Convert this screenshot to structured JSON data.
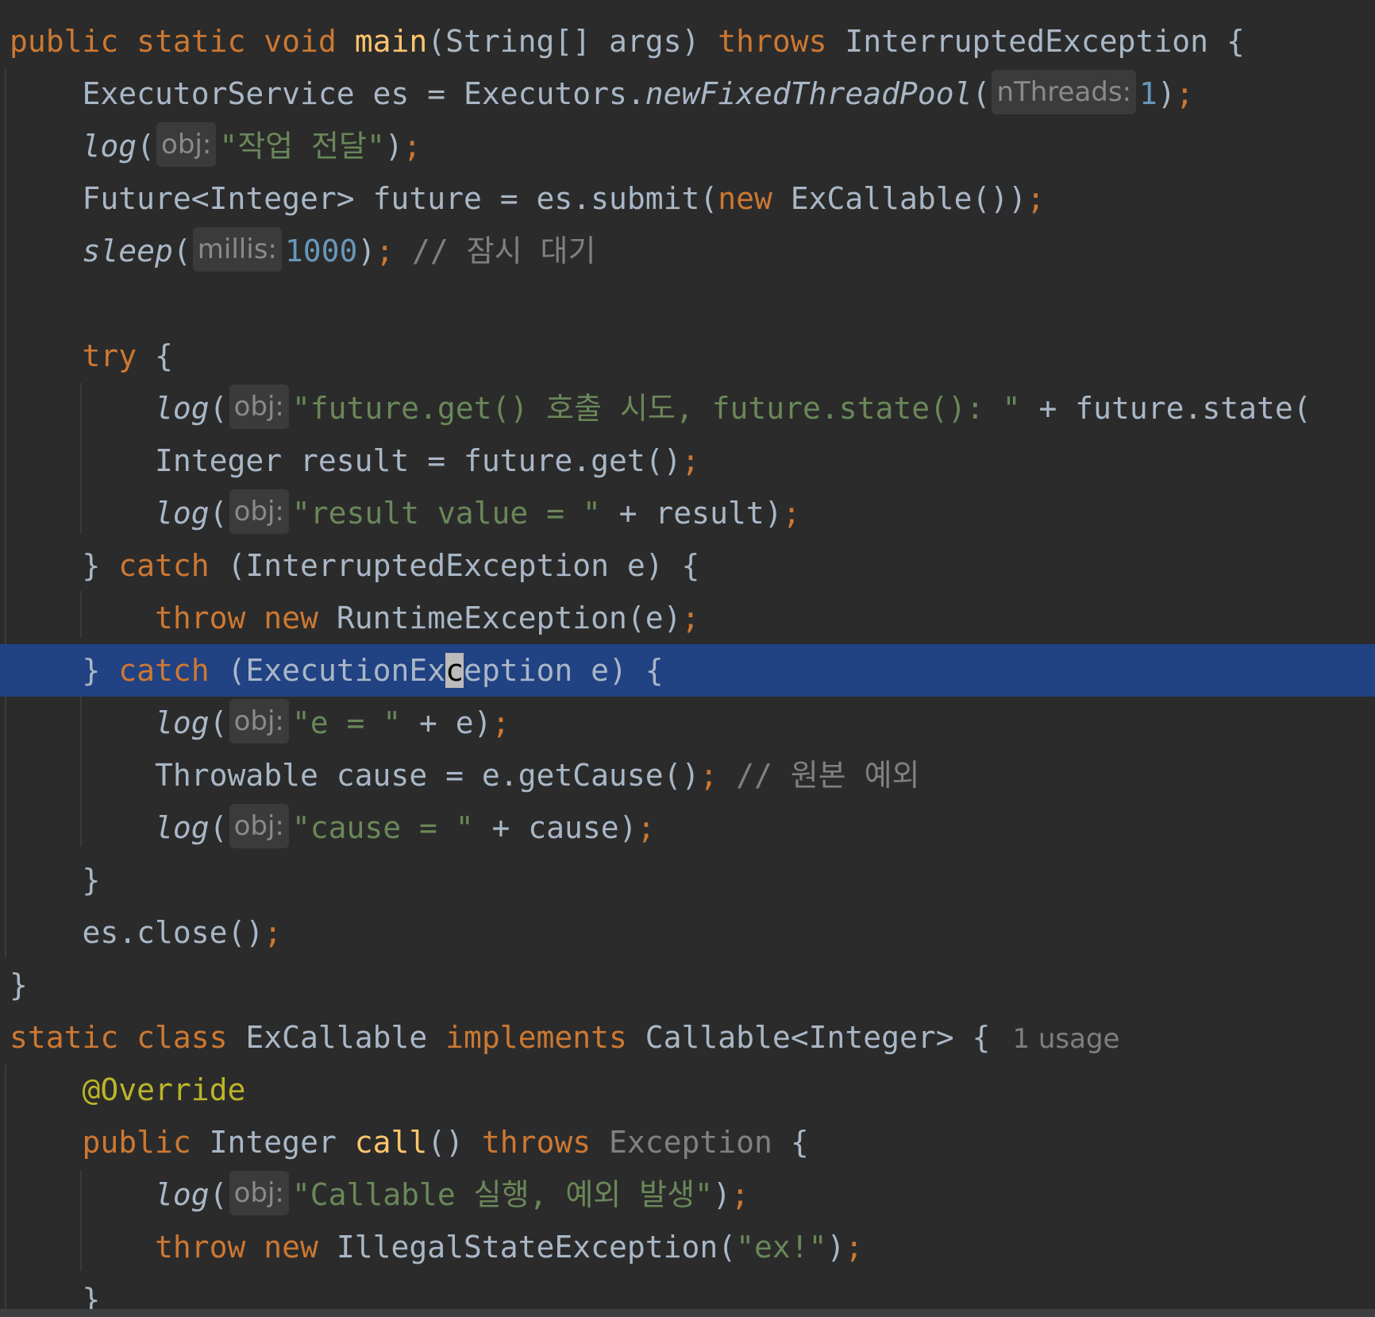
{
  "editor": {
    "language": "Java",
    "colors": {
      "background": "#2b2b2b",
      "current_line": "#214283",
      "keyword": "#cc7832",
      "method_decl": "#ffc66d",
      "string": "#6a8759",
      "number": "#6897bb",
      "comment": "#808080",
      "annotation": "#bbb529",
      "plain": "#a9b7c6"
    },
    "lines": [
      {
        "tokens": [
          {
            "t": "public static void ",
            "c": "kw"
          },
          {
            "t": "main",
            "c": "fn"
          },
          {
            "t": "(String[] args) ",
            "c": ""
          },
          {
            "t": "throws",
            "c": "kw"
          },
          {
            "t": " InterruptedException {",
            "c": ""
          }
        ]
      },
      {
        "tokens": [
          {
            "t": "    ExecutorService es = Executors.",
            "c": ""
          },
          {
            "t": "newFixedThreadPool",
            "c": "ital"
          },
          {
            "t": "(",
            "c": ""
          },
          {
            "t": "nThreads:",
            "c": "hint"
          },
          {
            "t": "1",
            "c": "num"
          },
          {
            "t": ")",
            "c": ""
          },
          {
            "t": ";",
            "c": "kw"
          }
        ]
      },
      {
        "tokens": [
          {
            "t": "    ",
            "c": ""
          },
          {
            "t": "log",
            "c": "ital"
          },
          {
            "t": "(",
            "c": ""
          },
          {
            "t": "obj:",
            "c": "hint"
          },
          {
            "t": "\"작업 전달\"",
            "c": "str"
          },
          {
            "t": ")",
            "c": ""
          },
          {
            "t": ";",
            "c": "kw"
          }
        ]
      },
      {
        "tokens": [
          {
            "t": "    Future<Integer> future = es.submit(",
            "c": ""
          },
          {
            "t": "new",
            "c": "kw"
          },
          {
            "t": " ExCallable())",
            "c": ""
          },
          {
            "t": ";",
            "c": "kw"
          }
        ]
      },
      {
        "tokens": [
          {
            "t": "    ",
            "c": ""
          },
          {
            "t": "sleep",
            "c": "ital"
          },
          {
            "t": "(",
            "c": ""
          },
          {
            "t": "millis:",
            "c": "hint"
          },
          {
            "t": "1000",
            "c": "num"
          },
          {
            "t": ")",
            "c": ""
          },
          {
            "t": ";",
            "c": "kw"
          },
          {
            "t": " // 잠시 대기",
            "c": "cmt"
          }
        ]
      },
      {
        "tokens": []
      },
      {
        "tokens": [
          {
            "t": "    ",
            "c": ""
          },
          {
            "t": "try",
            "c": "kw"
          },
          {
            "t": " {",
            "c": ""
          }
        ]
      },
      {
        "tokens": [
          {
            "t": "        ",
            "c": ""
          },
          {
            "t": "log",
            "c": "ital"
          },
          {
            "t": "(",
            "c": ""
          },
          {
            "t": "obj:",
            "c": "hint"
          },
          {
            "t": "\"future.get() 호출 시도, future.state(): \"",
            "c": "str"
          },
          {
            "t": " + future.state(",
            "c": ""
          }
        ]
      },
      {
        "tokens": [
          {
            "t": "        Integer result = future.get()",
            "c": ""
          },
          {
            "t": ";",
            "c": "kw"
          }
        ]
      },
      {
        "tokens": [
          {
            "t": "        ",
            "c": ""
          },
          {
            "t": "log",
            "c": "ital"
          },
          {
            "t": "(",
            "c": ""
          },
          {
            "t": "obj:",
            "c": "hint"
          },
          {
            "t": "\"result value = \"",
            "c": "str"
          },
          {
            "t": " + result)",
            "c": ""
          },
          {
            "t": ";",
            "c": "kw"
          }
        ]
      },
      {
        "tokens": [
          {
            "t": "    } ",
            "c": ""
          },
          {
            "t": "catch",
            "c": "kw"
          },
          {
            "t": " (InterruptedException e) {",
            "c": ""
          }
        ]
      },
      {
        "tokens": [
          {
            "t": "        ",
            "c": ""
          },
          {
            "t": "throw new",
            "c": "kw"
          },
          {
            "t": " RuntimeException(e)",
            "c": ""
          },
          {
            "t": ";",
            "c": "kw"
          }
        ]
      },
      {
        "current": true,
        "tokens": [
          {
            "t": "    } ",
            "c": ""
          },
          {
            "t": "catch",
            "c": "kw"
          },
          {
            "t": " (ExecutionEx",
            "c": ""
          },
          {
            "t": "c",
            "c": "caret"
          },
          {
            "t": "eption e) {",
            "c": ""
          }
        ]
      },
      {
        "tokens": [
          {
            "t": "        ",
            "c": ""
          },
          {
            "t": "log",
            "c": "ital"
          },
          {
            "t": "(",
            "c": ""
          },
          {
            "t": "obj:",
            "c": "hint"
          },
          {
            "t": "\"e = \"",
            "c": "str"
          },
          {
            "t": " + e)",
            "c": ""
          },
          {
            "t": ";",
            "c": "kw"
          }
        ]
      },
      {
        "tokens": [
          {
            "t": "        Throwable cause = e.getCause()",
            "c": ""
          },
          {
            "t": ";",
            "c": "kw"
          },
          {
            "t": " // 원본 예외",
            "c": "cmt"
          }
        ]
      },
      {
        "tokens": [
          {
            "t": "        ",
            "c": ""
          },
          {
            "t": "log",
            "c": "ital"
          },
          {
            "t": "(",
            "c": ""
          },
          {
            "t": "obj:",
            "c": "hint"
          },
          {
            "t": "\"cause = \"",
            "c": "str"
          },
          {
            "t": " + cause)",
            "c": ""
          },
          {
            "t": ";",
            "c": "kw"
          }
        ]
      },
      {
        "tokens": [
          {
            "t": "    }",
            "c": ""
          }
        ]
      },
      {
        "tokens": [
          {
            "t": "    es.close()",
            "c": ""
          },
          {
            "t": ";",
            "c": "kw"
          }
        ]
      },
      {
        "tokens": [
          {
            "t": "}",
            "c": ""
          }
        ]
      },
      {
        "tokens": [
          {
            "t": "static class",
            "c": "kw"
          },
          {
            "t": " ExCallable ",
            "c": ""
          },
          {
            "t": "implements",
            "c": "kw"
          },
          {
            "t": " Callable<Integer> {",
            "c": ""
          },
          {
            "t": "1 usage",
            "c": "usage"
          }
        ]
      },
      {
        "tokens": [
          {
            "t": "    ",
            "c": ""
          },
          {
            "t": "@Override",
            "c": "ann"
          }
        ]
      },
      {
        "tokens": [
          {
            "t": "    ",
            "c": ""
          },
          {
            "t": "public",
            "c": "kw"
          },
          {
            "t": " Integer ",
            "c": ""
          },
          {
            "t": "call",
            "c": "fn"
          },
          {
            "t": "() ",
            "c": ""
          },
          {
            "t": "throws",
            "c": "kw"
          },
          {
            "t": " ",
            "c": ""
          },
          {
            "t": "Exception",
            "c": "dim"
          },
          {
            "t": " {",
            "c": ""
          }
        ]
      },
      {
        "tokens": [
          {
            "t": "        ",
            "c": ""
          },
          {
            "t": "log",
            "c": "ital"
          },
          {
            "t": "(",
            "c": ""
          },
          {
            "t": "obj:",
            "c": "hint"
          },
          {
            "t": "\"Callable 실행, 예외 발생\"",
            "c": "str"
          },
          {
            "t": ")",
            "c": ""
          },
          {
            "t": ";",
            "c": "kw"
          }
        ]
      },
      {
        "tokens": [
          {
            "t": "        ",
            "c": ""
          },
          {
            "t": "throw new",
            "c": "kw"
          },
          {
            "t": " IllegalStateException(",
            "c": ""
          },
          {
            "t": "\"ex!\"",
            "c": "str"
          },
          {
            "t": ")",
            "c": ""
          },
          {
            "t": ";",
            "c": "kw"
          }
        ]
      },
      {
        "tokens": [
          {
            "t": "    }",
            "c": ""
          }
        ]
      }
    ]
  }
}
